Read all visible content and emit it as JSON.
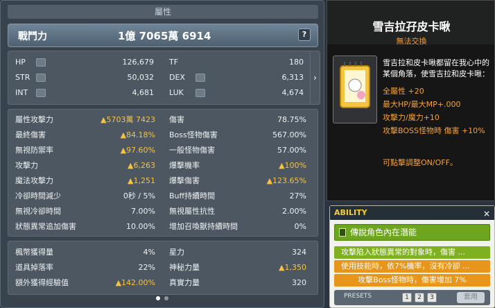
{
  "stat_window": {
    "title": "屬性",
    "combat_power_label": "戰鬥力",
    "combat_power_value": "1億 7065萬 6914",
    "help_label": "?",
    "expand_arrow": "›",
    "basic": [
      {
        "label": "HP",
        "value": "126,679"
      },
      {
        "label": "STR",
        "value": "50,032"
      },
      {
        "label": "INT",
        "value": "4,681"
      },
      {
        "label": "TF",
        "value": "180"
      },
      {
        "label": "DEX",
        "value": "6,313"
      },
      {
        "label": "LUK",
        "value": "4,674"
      }
    ],
    "detail": [
      {
        "label": "屬性攻擊力",
        "value": "▲5703萬 7423",
        "up": true
      },
      {
        "label": "最終傷害",
        "value": "▲84.18%",
        "up": true
      },
      {
        "label": "無視防禦率",
        "value": "▲97.60%",
        "up": true
      },
      {
        "label": "攻擊力",
        "value": "▲6,263",
        "up": true
      },
      {
        "label": "魔法攻擊力",
        "value": "▲1,251",
        "up": true
      },
      {
        "label": "冷卻時間減少",
        "value": "0秒 / 5%",
        "up": false
      },
      {
        "label": "無視冷卻時間",
        "value": "7.00%",
        "up": false
      },
      {
        "label": "狀態異常追加傷害",
        "value": "10.00%",
        "up": false
      },
      {
        "label": "傷害",
        "value": "78.75%",
        "up": false
      },
      {
        "label": "Boss怪物傷害",
        "value": "567.00%",
        "up": false
      },
      {
        "label": "一般怪物傷害",
        "value": "57.00%",
        "up": false
      },
      {
        "label": "爆擊機率",
        "value": "▲100%",
        "up": true
      },
      {
        "label": "爆擊傷害",
        "value": "▲123.65%",
        "up": true
      },
      {
        "label": "Buff持續時間",
        "value": "27%",
        "up": false
      },
      {
        "label": "無視屬性抗性",
        "value": "2.00%",
        "up": false
      },
      {
        "label": "增加召喚獸持續時間",
        "value": "0%",
        "up": false
      }
    ],
    "extra": [
      {
        "label": "楓幣獲得量",
        "value": "4%",
        "up": false
      },
      {
        "label": "道具掉落率",
        "value": "22%",
        "up": false
      },
      {
        "label": "額外獲得經驗值",
        "value": "▲142.00%",
        "up": true
      },
      {
        "label": "星力",
        "value": "324",
        "up": false
      },
      {
        "label": "神秘力量",
        "value": "▲1,350",
        "up": true
      },
      {
        "label": "真實力量",
        "value": "320",
        "up": false
      }
    ]
  },
  "tooltip": {
    "title": "雪吉拉孖皮卡啾",
    "subtitle": "無法交換",
    "description": "雪吉拉和皮卡啾都留在我心中的某個角落，使雪吉拉和皮卡啾：",
    "effects": [
      "全屬性 +20",
      "最大HP/最大MP+.000",
      "攻擊力/魔力+10",
      "攻擊BOSS怪物時 傷害 +10%"
    ],
    "toggle_text": "可點擊調整ON/OFF。"
  },
  "ability": {
    "header": "ABILITY",
    "close": "×",
    "rank": "傳說角色內在潛能",
    "lines": [
      {
        "text": "攻擊陷入狀態異常的對象時，傷害 ...",
        "color": "#7fb01f"
      },
      {
        "text": "使用技能時，依7%機率，沒有冷卻 ...",
        "color": "#e8951c"
      },
      {
        "text": "攻擊Boss怪物時，傷害增加 7%",
        "color": "#e8951c"
      }
    ],
    "presets_label": "PRESETS",
    "presets": [
      "1",
      "2",
      "3"
    ],
    "apply_label": "套用"
  },
  "colors": {
    "up_arrow": "#f6c244",
    "rank_green": "#6ea51e",
    "accent_orange": "#e8951c"
  }
}
